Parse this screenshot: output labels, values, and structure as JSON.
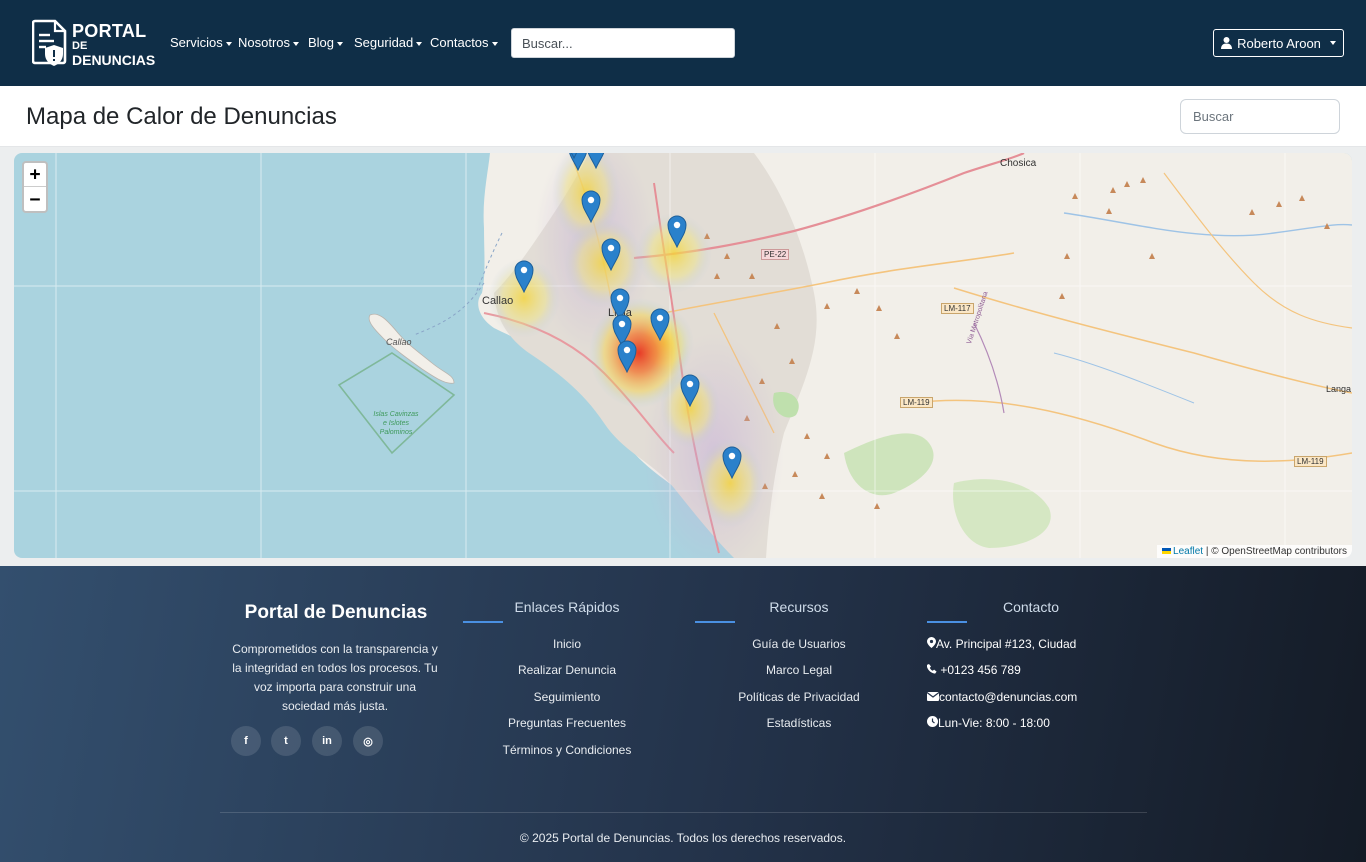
{
  "nav": {
    "logo": {
      "line1": "PORTAL",
      "line2": "DE",
      "line3": "DENUNCIAS"
    },
    "menu": [
      {
        "label": "Servicios"
      },
      {
        "label": "Nosotros"
      },
      {
        "label": "Blog"
      },
      {
        "label": "Seguridad"
      },
      {
        "label": "Contactos"
      }
    ],
    "search_placeholder": "Buscar...",
    "user_name": "Roberto Aroon"
  },
  "page": {
    "title": "Mapa de Calor de Denuncias",
    "search_placeholder": "Buscar"
  },
  "map": {
    "zoom_in": "+",
    "zoom_out": "−",
    "labels": {
      "chosica": "Chosica",
      "callao_city": "Callao",
      "callao_island": "Callao",
      "lima": "Lima",
      "langa": "Langa",
      "islands": [
        "Islas Cavinzas",
        "e Islotes",
        "Palominos"
      ],
      "route_pe22": "PE-22",
      "route_lm117": "LM-117",
      "route_lm119a": "LM-119",
      "route_lm119b": "LM-119",
      "via_metro": "Vía Metropolitana"
    },
    "attribution": {
      "leaflet": "Leaflet",
      "rest": "| © OpenStreetMap contributors"
    },
    "marker_count": 13
  },
  "footer": {
    "brand": "Portal de Denuncias",
    "description": "Comprometidos con la transparencia y la integridad en todos los procesos. Tu voz importa para construir una sociedad más justa.",
    "social": [
      {
        "icon": "facebook-icon",
        "glyph": "f"
      },
      {
        "icon": "twitter-icon",
        "glyph": "t"
      },
      {
        "icon": "linkedin-icon",
        "glyph": "in"
      },
      {
        "icon": "instagram-icon",
        "glyph": "◎"
      }
    ],
    "quick_links": {
      "title": "Enlaces Rápidos",
      "items": [
        "Inicio",
        "Realizar Denuncia",
        "Seguimiento",
        "Preguntas Frecuentes",
        "Términos y Condiciones"
      ]
    },
    "resources": {
      "title": "Recursos",
      "items": [
        "Guía de Usuarios",
        "Marco Legal",
        "Políticas de Privacidad",
        "Estadísticas"
      ]
    },
    "contact": {
      "title": "Contacto",
      "address": "Av. Principal #123, Ciudad",
      "phone": "+0123 456 789",
      "email": "contacto@denuncias.com",
      "hours": "Lun-Vie: 8:00 - 18:00"
    },
    "copyright": "© 2025 Portal de Denuncias. Todos los derechos reservados."
  }
}
